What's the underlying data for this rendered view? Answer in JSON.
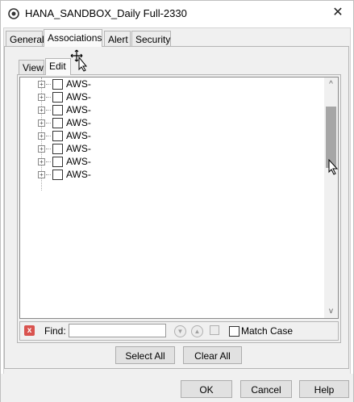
{
  "window": {
    "title": "HANA_SANDBOX_Daily Full-2330",
    "close_glyph": "✕",
    "app_icon": "backup-app-icon"
  },
  "tabs": [
    {
      "label": "General",
      "active": false
    },
    {
      "label": "Associations",
      "active": true
    },
    {
      "label": "Alert",
      "active": false
    },
    {
      "label": "Security",
      "active": false
    }
  ],
  "inner_tabs": [
    {
      "label": "View",
      "active": false
    },
    {
      "label": "Edit",
      "active": true
    }
  ],
  "tree": {
    "items": [
      {
        "label": "AWS-",
        "checked": false
      },
      {
        "label": "AWS-",
        "checked": false
      },
      {
        "label": "AWS-",
        "checked": false
      },
      {
        "label": "AWS-",
        "checked": false
      },
      {
        "label": "AWS-",
        "checked": false
      },
      {
        "label": "AWS-",
        "checked": false
      },
      {
        "label": "AWS-",
        "checked": false
      },
      {
        "label": "AWS-",
        "checked": false
      }
    ],
    "scroll_up_glyph": "^",
    "scroll_down_glyph": "v"
  },
  "find": {
    "label": "Find:",
    "value": "",
    "match_case_label": "Match Case",
    "match_case_checked": false
  },
  "buttons": {
    "select_all": "Select All",
    "clear_all": "Clear All",
    "ok": "OK",
    "cancel": "Cancel",
    "help": "Help"
  },
  "colors": {
    "panel": "#f0f0f0",
    "find_close": "#d9534f",
    "scroll_thumb": "#a6a6a6"
  }
}
